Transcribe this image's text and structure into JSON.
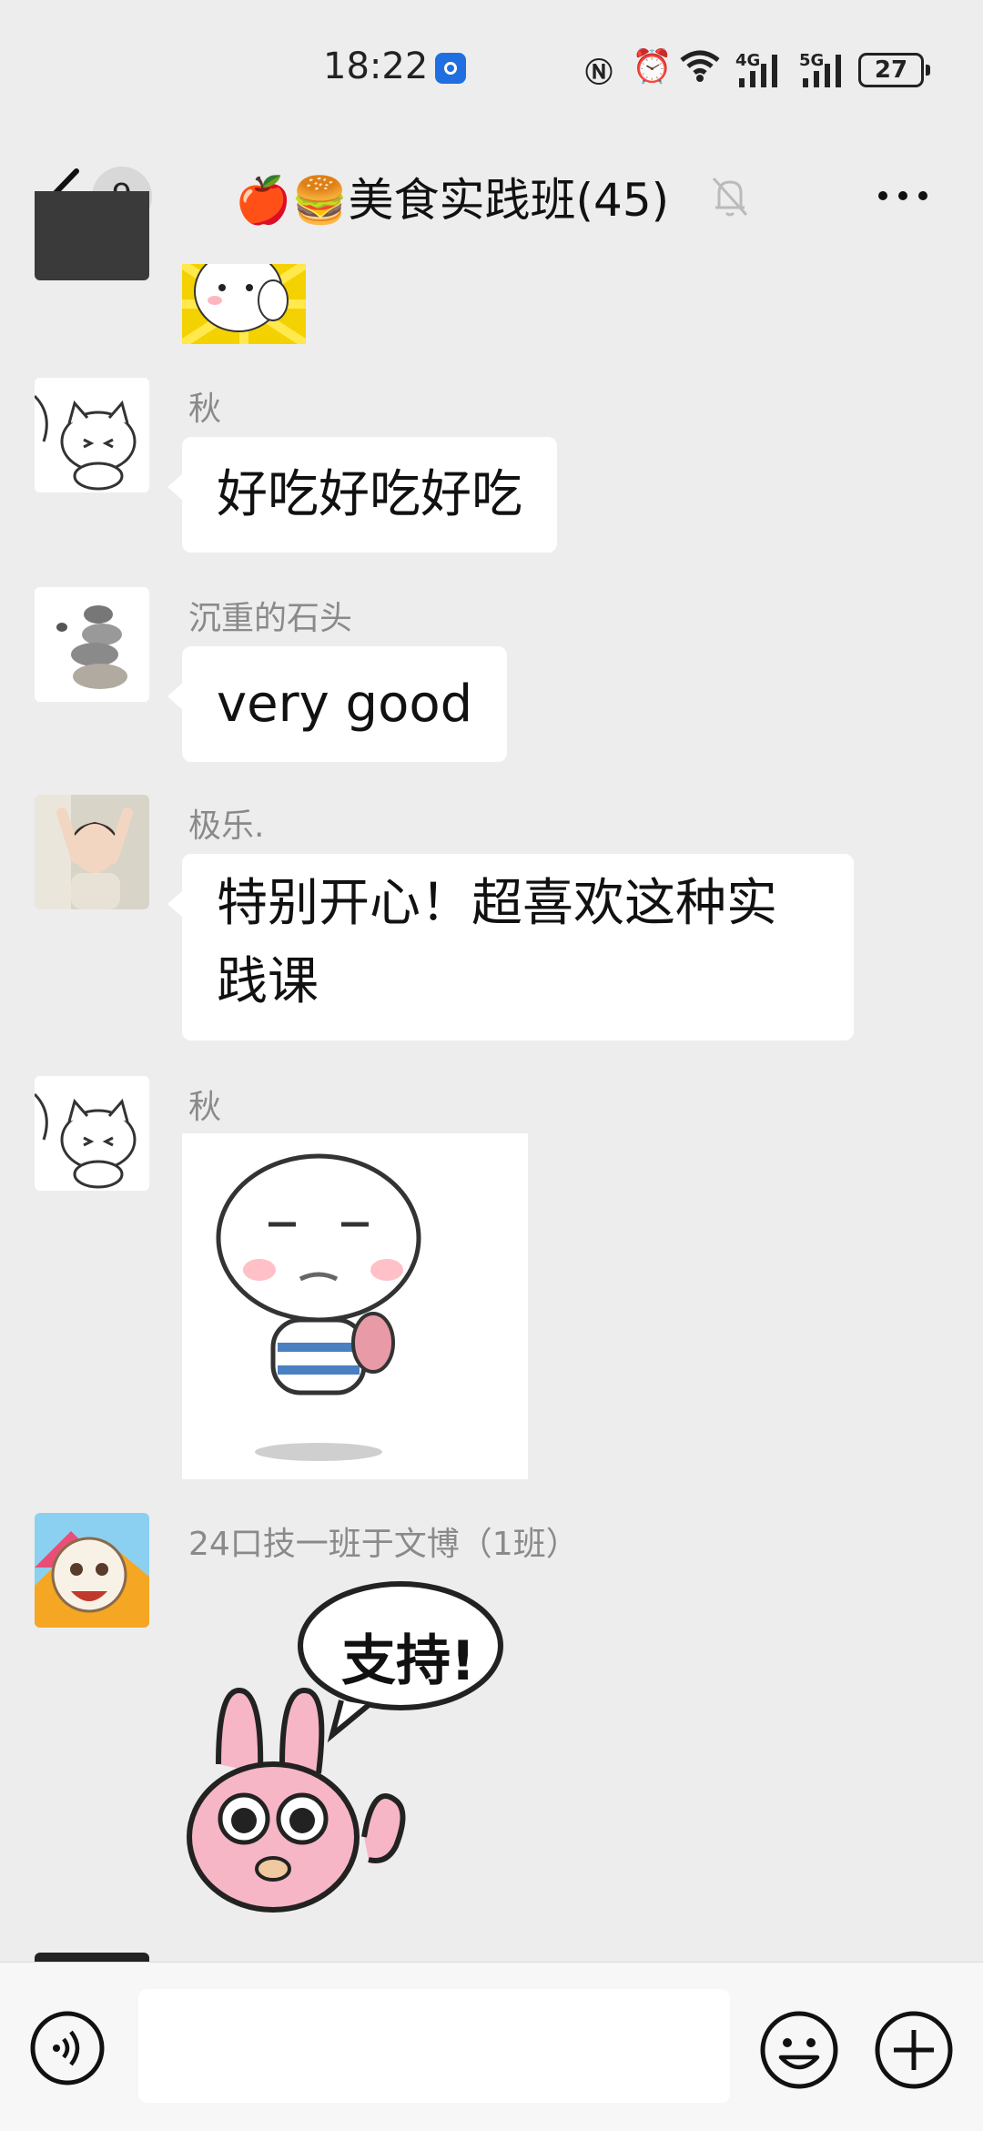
{
  "status_bar": {
    "time": "18:22",
    "network_left": "4G",
    "network_right": "5G",
    "battery": "27"
  },
  "header": {
    "unread_count": "9",
    "title": "🍎🍔美食实践班(45)",
    "back_icon": "chevron-left-icon",
    "mute_icon": "bell-muted-icon",
    "more_icon": "more-dots-icon"
  },
  "messages": [
    {
      "sender": "",
      "type": "sticker",
      "sticker": "thumbs-up-blob-sticker"
    },
    {
      "sender": "秋",
      "type": "text",
      "text": "好吃好吃好吃"
    },
    {
      "sender": "沉重的石头",
      "type": "text",
      "text": "very good"
    },
    {
      "sender": "极乐.",
      "type": "text",
      "lines": [
        "特别开心！超喜欢这种实",
        "践课"
      ]
    },
    {
      "sender": "秋",
      "type": "sticker",
      "sticker": "round-face-walking-sticker"
    },
    {
      "sender": "24口技一班于文博（1班）",
      "type": "sticker",
      "sticker": "pink-bunny-support-sticker",
      "sticker_text": "支持!"
    }
  ],
  "input_bar": {
    "voice_icon": "voice-icon",
    "emoji_icon": "emoji-icon",
    "plus_icon": "plus-icon",
    "placeholder": ""
  },
  "colors": {
    "background": "#ededed",
    "bubble": "#ffffff",
    "sender_text": "#8a8a8a",
    "location_badge": "#1f6fe0"
  }
}
